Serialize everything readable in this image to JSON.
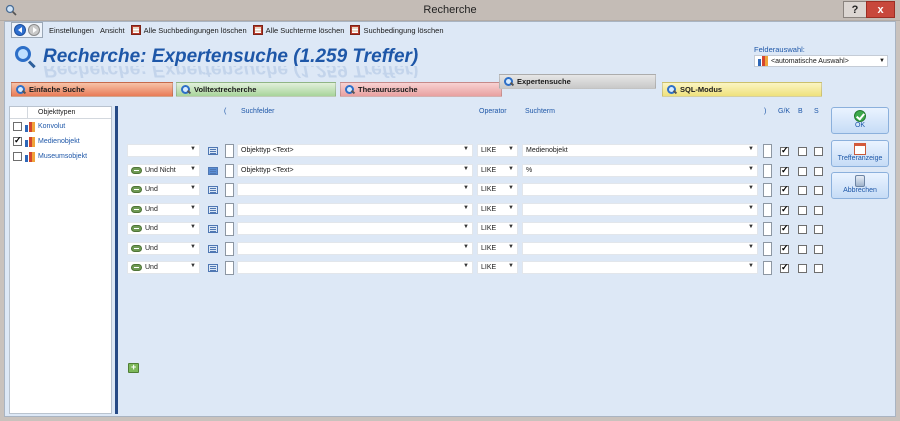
{
  "window": {
    "title": "Recherche",
    "help_label": "?",
    "close_label": "x"
  },
  "toolbar": {
    "items": [
      {
        "label": "Einstellungen"
      },
      {
        "label": "Ansicht"
      },
      {
        "label": "Alle Suchbedingungen löschen"
      },
      {
        "label": "Alle Suchterme löschen"
      },
      {
        "label": "Suchbedingung löschen"
      }
    ]
  },
  "heading": {
    "title": "Recherche: Expertensuche (1.259 Treffer)"
  },
  "felderauswahl": {
    "label": "Felderauswahl:",
    "value": "<automatische Auswahl>"
  },
  "tabs": [
    {
      "label": "Einfache Suche",
      "color": "#e87b57"
    },
    {
      "label": "Volltextrecherche",
      "color": "#a8d49b"
    },
    {
      "label": "Thesaurussuche",
      "color": "#e8a0a0"
    },
    {
      "label": "Expertensuche",
      "color": "#c9c9c9",
      "active": true
    },
    {
      "label": "SQL-Modus",
      "color": "#efe17c"
    }
  ],
  "sidebar": {
    "header": "Objekttypen",
    "items": [
      {
        "label": "Konvolut",
        "checked": false
      },
      {
        "label": "Medienobjekt",
        "checked": true
      },
      {
        "label": "Museumsobjekt",
        "checked": false
      }
    ]
  },
  "grid": {
    "headers": {
      "open_paren": "(",
      "fields": "Suchfelder",
      "operator": "Operator",
      "term": "Suchterm",
      "close_paren": ")",
      "gk": "G/K",
      "b": "B",
      "s": "S"
    },
    "rows": [
      {
        "connector": "",
        "field": "Objekttyp <Text>",
        "operator": "LIKE",
        "term": "Medienobjekt",
        "gk": true,
        "b": false,
        "s": false
      },
      {
        "connector": "Und Nicht",
        "field": "Objekttyp <Text>",
        "operator": "LIKE",
        "term": "%",
        "gk": true,
        "b": false,
        "s": false
      },
      {
        "connector": "Und",
        "field": "",
        "operator": "LIKE",
        "term": "",
        "gk": true,
        "b": false,
        "s": false
      },
      {
        "connector": "Und",
        "field": "",
        "operator": "LIKE",
        "term": "",
        "gk": true,
        "b": false,
        "s": false
      },
      {
        "connector": "Und",
        "field": "",
        "operator": "LIKE",
        "term": "",
        "gk": true,
        "b": false,
        "s": false
      },
      {
        "connector": "Und",
        "field": "",
        "operator": "LIKE",
        "term": "",
        "gk": true,
        "b": false,
        "s": false
      },
      {
        "connector": "Und",
        "field": "",
        "operator": "LIKE",
        "term": "",
        "gk": true,
        "b": false,
        "s": false
      }
    ]
  },
  "actions": {
    "ok": "OK",
    "trefferanzeige": "Trefferanzeige",
    "abbrechen": "Abbrechen"
  }
}
